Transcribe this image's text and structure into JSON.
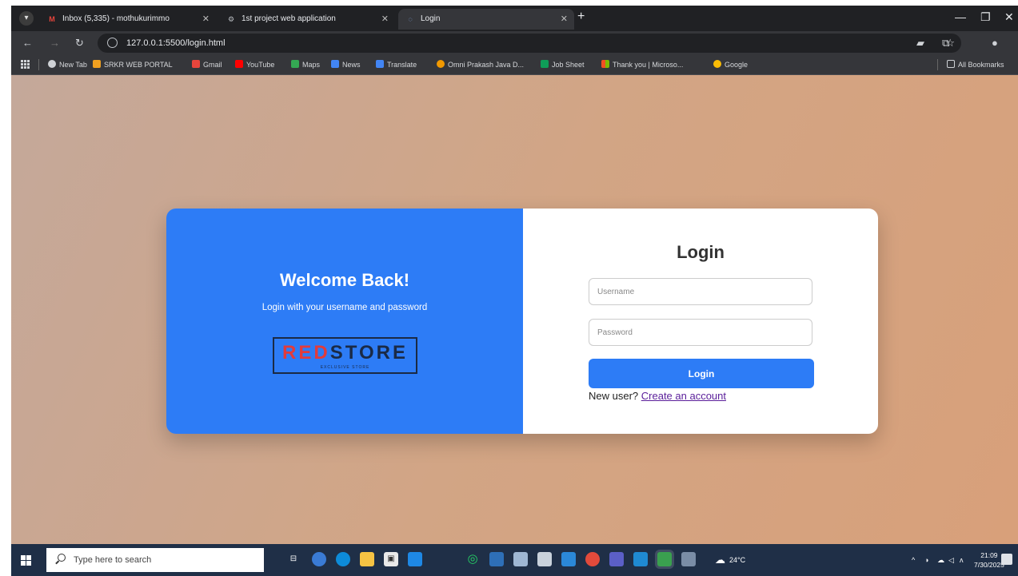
{
  "browser": {
    "tabs": [
      {
        "title": "Inbox (5,335) - mothukurimmo",
        "icon": "gmail-icon",
        "icon_glyph": "M",
        "icon_color": "#e8453c",
        "active": false
      },
      {
        "title": "1st project web application",
        "icon": "globe-icon",
        "icon_glyph": "⚙",
        "icon_color": "#bdc1c6",
        "active": false
      },
      {
        "title": "Login",
        "icon": "globe-icon",
        "icon_glyph": "◌",
        "icon_color": "#8ab4f8",
        "active": true
      }
    ],
    "url": "127.0.0.1:5500/login.html",
    "bookmarks": [
      {
        "label": "New Tab",
        "color": "#cfd2d6"
      },
      {
        "label": "SRKR WEB PORTAL",
        "color": "#f0a020"
      },
      {
        "label": "Gmail",
        "color": "#e8453c"
      },
      {
        "label": "YouTube",
        "color": "#ff0000"
      },
      {
        "label": "Maps",
        "color": "#34a853"
      },
      {
        "label": "News",
        "color": "#4285f4"
      },
      {
        "label": "Translate",
        "color": "#4285f4"
      },
      {
        "label": "Omni Prakash Java D...",
        "color": "#f29900"
      },
      {
        "label": "Job Sheet",
        "color": "#0f9d58"
      },
      {
        "label": "Thank you | Microso...",
        "color": "#f25022"
      },
      {
        "label": "Google",
        "color": "#fbbc05"
      }
    ],
    "all_bookmarks": "All Bookmarks"
  },
  "page": {
    "welcome_title": "Welcome Back!",
    "welcome_sub": "Login with your username and password",
    "logo": {
      "part_red": "RED",
      "part_dark": "STORE",
      "tagline": "EXCLUSIVE STORE",
      "red_color": "#e23b3b"
    },
    "login_title": "Login",
    "username_placeholder": "Username",
    "password_placeholder": "Password",
    "login_button": "Login",
    "new_user_text": "New user?",
    "create_link": "Create an account",
    "accent_color": "#2d7cf6"
  },
  "taskbar": {
    "search_placeholder": "Type here to search",
    "weather": "24°C",
    "time": "21:09",
    "date": "7/30/2025"
  }
}
